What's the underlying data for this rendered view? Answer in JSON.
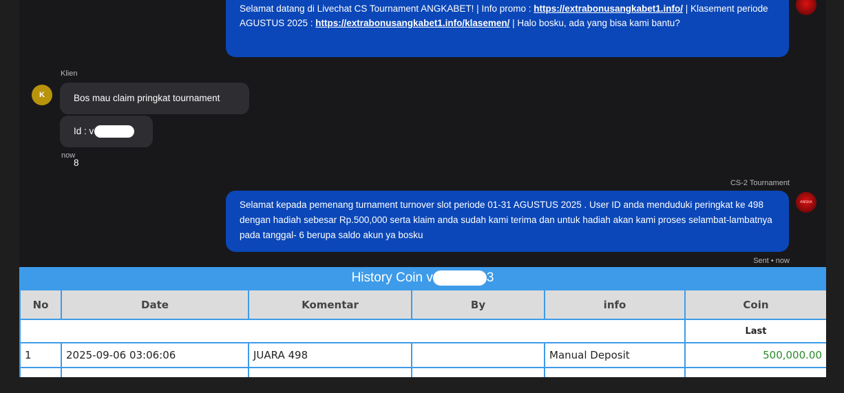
{
  "chat": {
    "welcome": {
      "text1": "Selamat datang di Livechat CS Tournament ANGKABET! | Info promo : ",
      "link1": "https://extrabonusangkabet1.info/",
      "text2": " | Klasement periode AGUSTUS 2025 : ",
      "link2": "https://extrabonusangkabet1.info/klasemen/",
      "text3": " | Halo bosku, ada yang bisa kami bantu?"
    },
    "client_label": "Klien",
    "client_initial": "K",
    "client_msg1": "Bos mau claim pringkat tournament",
    "client_msg2_prefix": "Id : v",
    "client_msg2_suffix": "8",
    "client_time": "now",
    "agent_name": "CS-2 Tournament",
    "agent_msg": "Selamat kepada pemenang turnament turnover slot periode 01-31 AGUSTUS 2025 . User ID anda menduduki peringkat ke 498 dengan hadiah sebesar Rp.500,000 serta klaim anda sudah kami terima dan untuk hadiah akan kami proses selambat-lambatnya pada tanggal- 6 berupa saldo akun ya bosku",
    "agent_status": "Sent • now"
  },
  "history": {
    "title_prefix": "History Coin v",
    "title_suffix": "3",
    "columns": [
      "No",
      "Date",
      "Komentar",
      "By",
      "info",
      "Coin"
    ],
    "last_label": "Last",
    "rows": [
      {
        "no": "1",
        "date": "2025-09-06 03:06:06",
        "komentar": "JUARA 498",
        "by": "",
        "info": "Manual Deposit",
        "coin": "500,000.00"
      }
    ]
  },
  "colors": {
    "agent_bubble": "#0b47b8",
    "table_accent": "#3d9be9",
    "coin_green": "#2a8a2a"
  }
}
